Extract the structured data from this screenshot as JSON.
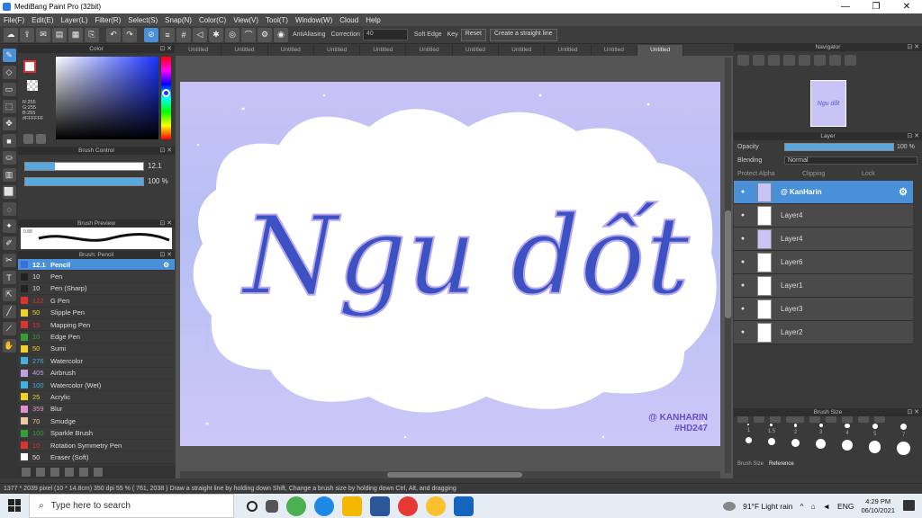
{
  "window": {
    "title": "MediBang Paint Pro (32bit)",
    "controls": [
      "—",
      "❐",
      "✕"
    ]
  },
  "menu": [
    "File(F)",
    "Edit(E)",
    "Layer(L)",
    "Filter(R)",
    "Select(S)",
    "Snap(N)",
    "Color(C)",
    "View(V)",
    "Tool(T)",
    "Window(W)",
    "Cloud",
    "Help"
  ],
  "toolbar": {
    "antialiasing": "AntiAliasing",
    "correction_label": "Correction",
    "correction_value": "40",
    "soft_edge": "Soft Edge",
    "key": "Key",
    "reset": "Reset",
    "straight_line": "Create a straight line"
  },
  "color_panel": {
    "title": "Color",
    "rgb": "R:255\nG:255\nB:255\n#FFFFFF"
  },
  "brush_control": {
    "title": "Brush Control",
    "size": "12.1",
    "opacity": "100 %",
    "size_fraction": 0.25,
    "opacity_fraction": 1.0
  },
  "brush_preview": {
    "title": "Brush Preview",
    "size_label": "0.88"
  },
  "brush_list": {
    "title": "Brush: Pencil",
    "items": [
      {
        "size": "12.1",
        "name": "Pencil",
        "color": "#3a6fd8",
        "selected": true
      },
      {
        "size": "10",
        "name": "Pen",
        "color": "#222222"
      },
      {
        "size": "10",
        "name": "Pen (Sharp)",
        "color": "#222222"
      },
      {
        "size": "122",
        "name": "G Pen",
        "color": "#e03030"
      },
      {
        "size": "50",
        "name": "Slipple Pen",
        "color": "#f0d020"
      },
      {
        "size": "15",
        "name": "Mapping Pen",
        "color": "#e03030"
      },
      {
        "size": "10",
        "name": "Edge Pen",
        "color": "#30a030"
      },
      {
        "size": "50",
        "name": "Sumi",
        "color": "#f0d020"
      },
      {
        "size": "276",
        "name": "Watercolor",
        "color": "#40b0e0"
      },
      {
        "size": "405",
        "name": "Airbrush",
        "color": "#c0a0e0"
      },
      {
        "size": "100",
        "name": "Watercolor (Wet)",
        "color": "#40b0e0"
      },
      {
        "size": "25",
        "name": "Acrylic",
        "color": "#f0d020"
      },
      {
        "size": "359",
        "name": "Blur",
        "color": "#e090d0"
      },
      {
        "size": "70",
        "name": "Smudge",
        "color": "#f0c8a0"
      },
      {
        "size": "100",
        "name": "Sparkle Brush",
        "color": "#30a030"
      },
      {
        "size": "10",
        "name": "Rotation Symmetry Pen",
        "color": "#e03030"
      },
      {
        "size": "50",
        "name": "Eraser (Soft)",
        "color": "#ffffff"
      }
    ]
  },
  "tabs": [
    "Untitled",
    "Untitled",
    "Untitled",
    "Untitled",
    "Untitled",
    "Untitled",
    "Untitled",
    "Untitled",
    "Untitled",
    "Untitled",
    "Untitled"
  ],
  "artwork": {
    "text": "Ngu dốt",
    "signature": "@ KANHARIN",
    "hashtag": "#HD247"
  },
  "navigator": {
    "title": "Navigator",
    "thumb_text": "Ngu dốt"
  },
  "layer_panel": {
    "title": "Layer",
    "opacity_label": "Opacity",
    "opacity_value": "100 %",
    "opacity_fraction": 1.0,
    "blending_label": "Blending",
    "blending_value": "Normal",
    "protect_alpha": "Protect Alpha",
    "clipping": "Clipping",
    "lock": "Lock",
    "layers": [
      {
        "name": "@ KanHarin",
        "selected": true
      },
      {
        "name": "Layer4"
      },
      {
        "name": "Layer4"
      },
      {
        "name": "Layer6"
      },
      {
        "name": "Layer1"
      },
      {
        "name": "Layer3"
      },
      {
        "name": "Layer2"
      }
    ]
  },
  "brush_size_panel": {
    "title": "Brush Size",
    "sizes": [
      "1",
      "1.5",
      "2",
      "3",
      "4",
      "5",
      "7"
    ],
    "tabs": [
      "Brush Size",
      "Reference"
    ]
  },
  "status": "1377 * 2039 pixel  (10 * 14.8cm)  350 dpi  55 %  ( 761, 2038 )  Draw a straight line by holding down Shift, Change a brush size by holding down Ctrl, Alt, and dragging",
  "taskbar": {
    "search_placeholder": "Type here to search",
    "weather": "91°F  Light rain",
    "lang": "ENG",
    "time": "4:29 PM",
    "date": "06/10/2021"
  }
}
